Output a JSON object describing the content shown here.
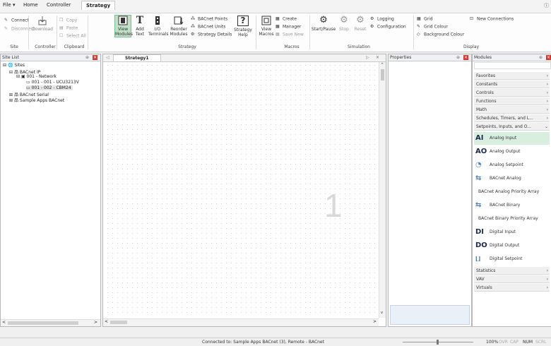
{
  "menu": {
    "file": "File",
    "home": "Home",
    "controller": "Controller",
    "strategy": "Strategy"
  },
  "ribbon": {
    "connect": "Connect",
    "disconnect": "Disconnect",
    "download": "Download",
    "copy": "Copy",
    "paste": "Paste",
    "select_all": "Select All",
    "view": "View",
    "modules": "Modules",
    "add": "Add",
    "text": "Text",
    "io": "I/O",
    "terminals": "Terminals",
    "reorder": "Reorder",
    "reorder_modules": "Modules",
    "bacnet_points": "BACnet Points",
    "bacnet_units": "BACnet Units",
    "strategy_details": "Strategy Details",
    "strategy_help_1": "Strategy",
    "strategy_help_2": "Help",
    "view_macros_1": "View",
    "view_macros_2": "Macros",
    "create": "Create",
    "manager": "Manager",
    "save_new": "Save New",
    "start_pause": "Start/Pause",
    "stop": "Stop",
    "reset": "Reset",
    "logging": "Logging",
    "configuration": "Configuration",
    "grid": "Grid",
    "grid_colour": "Grid Colour",
    "background_colour": "Background Colour",
    "new_connections": "New Connections",
    "groups": {
      "site": "Site",
      "controller": "Controller",
      "clipboard": "Clipboard",
      "strategy": "Strategy",
      "macros": "Macros",
      "simulation": "Simulation",
      "display": "Display"
    }
  },
  "site_list": {
    "title": "Site List",
    "tree": [
      "Sites",
      "BACnet IP",
      "001 - Network",
      "001 - 001 - UCU3213V",
      "001 - 002 - CBM24",
      "BACnet Serial",
      "Sample Apps BACnet"
    ]
  },
  "strategy": {
    "tab": "Strategy1",
    "page_number": "1"
  },
  "properties": {
    "title": "Properties"
  },
  "modules": {
    "title": "Modules",
    "categories_top": [
      "Favorites",
      "Constants",
      "Controls",
      "Functions",
      "Math",
      "Schedules, Timers, and L...",
      "Setpoints, Inputs, and O..."
    ],
    "items": [
      {
        "icon": "AI",
        "label": "Analog Input"
      },
      {
        "icon": "AO",
        "label": "Analog Output"
      },
      {
        "icon": "◔",
        "label": "Analog Setpoint"
      },
      {
        "icon": "⇆",
        "label": "BACnet Analog"
      },
      {
        "icon": "",
        "label": "BACnet Analog Priority Array"
      },
      {
        "icon": "⇆",
        "label": "BACnet Binary"
      },
      {
        "icon": "",
        "label": "BACnet Binary Priority Array"
      },
      {
        "icon": "DI",
        "label": "Digital Input"
      },
      {
        "icon": "DO",
        "label": "Digital Output"
      },
      {
        "icon": "⌊⌋",
        "label": "Digital Setpoint"
      }
    ],
    "categories_bottom": [
      "Statistics",
      "VAV",
      "Virtuals"
    ]
  },
  "status": {
    "connected": "Connected to: Sample Apps BACnet (3), Remote - BACnet",
    "zoom": "100%",
    "ovr": "OVR",
    "cap": "CAP",
    "num": "NUM",
    "scrl": "SCRL"
  },
  "colors": {
    "accent_green": "#2e8b3d",
    "close_red": "#d9352b",
    "selection": "#d8efe0"
  }
}
